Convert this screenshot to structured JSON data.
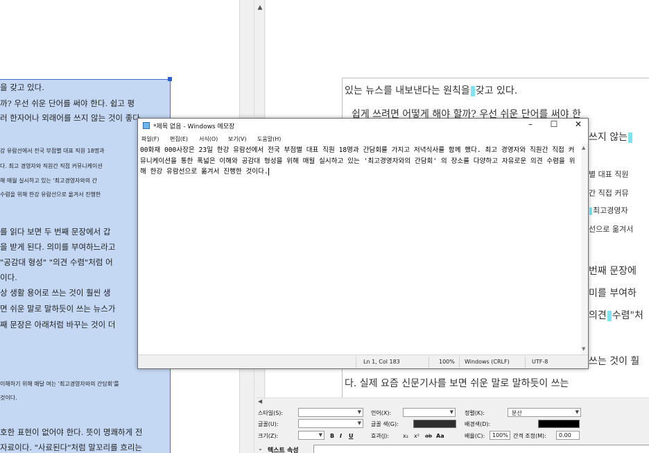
{
  "left_doc": {
    "lines": [
      "을 갖고 있다.",
      "까? 우선 쉬운 단어를 써야 한다. 쉽고 평",
      "러 한자어나 외래어를 쓰지 않는 것이 좋다",
      "강 유람선에서 전국 부점별 대표 직원 18명과",
      "다. 최고 경영자와 직원간 직접 커뮤니케이션",
      "해 매월 실시하고 있는 '최고경영자와의 간",
      "수렴을 위해 한강 유람선으로 옮겨서 진행한",
      "를 읽다 보면 두 번째 문장에서 갑",
      "을 받게 된다. 의미를 부여하느라고",
      "\"공감대 형성\" \"의견 수렴\"처럼 어",
      "이다.",
      "상 생활 용어로 쓰는 것이 훨씬 생",
      "면 쉬운 말로 말하듯이 쓰는 뉴스가",
      "째 문장은 아래처럼 바꾸는 것이 더",
      "이해하기 위해 매달 여는 '최고경영자와의 간담회'를",
      "것이다.",
      "호한 표현이 없어야 한다. 뜻이 명쾌하게 전",
      "자료이다. \"사료된다\"처럼 말꼬리를 흐리는"
    ]
  },
  "right_doc": {
    "line1_a": "있는 뉴스를 내보낸다는 원칙을",
    "line1_b": "갖고 있다.",
    "line2": "쉽게 쓰려면 어떻게 해야 할까? 우선 쉬운 단어를 써야 한",
    "line3_a": "쓰지 않는",
    "line4": "별 대표 직원",
    "line5": "간 직접 커뮤",
    "line6_b": "최고경영자",
    "line7": "선으로 옮겨서",
    "line8": "번째 문장에",
    "line9": "미를 부여하",
    "line10_a": "의견",
    "line10_b": "수렴\"처",
    "line11": "쓰는 것이 훨",
    "line12": "다. 실제 요즘 신문기사를 보면 쉬운 말로 말하듯이 쓰는"
  },
  "notepad": {
    "title": "*제목 없음 - Windows 메모장",
    "minimize": "–",
    "maximize": "☐",
    "close": "✕",
    "menu": [
      "파일(F)",
      "편집(E)",
      "서식(O)",
      "보기(V)",
      "도움말(H)"
    ],
    "text": "00화재 000사장은 23일 한강 유람선에서 전국 부점별 대표 직원 18명과 간담회를 가지고 저녁식사를 함께 했다. 최고 경영자와 직원간 직접 커뮤니케이션을 통한 폭넓은 이해와 공감대 형성을 위해 매월 실시하고 있는 '최고경영자와의 간담회' 의 장소를 다양하고 자유로운 의견 수렴을 위해 한강 유람선으로 옮겨서 진행한 것이다.",
    "status": {
      "position": "Ln 1, Col 183",
      "zoom": "100%",
      "line_ending": "Windows (CRLF)",
      "encoding": "UTF-8"
    }
  },
  "props": {
    "style_label": "스타일(S):",
    "font_label": "글꼴(U):",
    "size_label": "크기(Z):",
    "lang_label": "언어(X):",
    "color_label": "글꼴 색(G):",
    "effect_label": "효과(J):",
    "align_label": "정렬(K):",
    "align_value": "분산",
    "bg_label": "배경색(D):",
    "scale_label": "배율(C):",
    "scale_value": "100%",
    "spacing_label": "간격 조정(M):",
    "spacing_value": "0.00",
    "bold": "B",
    "italic": "I",
    "underline": "U",
    "sub": "x₂",
    "sup": "x²",
    "strike": "ab",
    "caps": "Aa",
    "panel_caption": "텍스트 속성"
  },
  "colors": {
    "selection": "#c4d8f4",
    "selection_border": "#3b6fd6",
    "caret_highlight": "#7fe3f0"
  }
}
